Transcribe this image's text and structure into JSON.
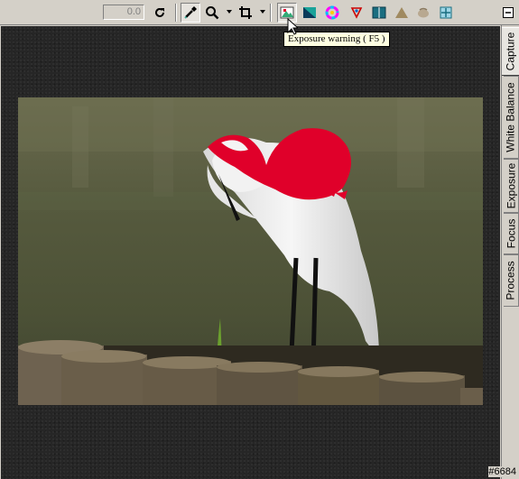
{
  "toolbar": {
    "rotation_value": "0.0",
    "tools": [
      {
        "name": "rotate",
        "icon": "rotate-icon"
      },
      {
        "name": "eyedropper",
        "icon": "eyedropper-icon"
      },
      {
        "name": "zoom",
        "icon": "magnifier-icon"
      },
      {
        "name": "crop",
        "icon": "crop-icon"
      },
      {
        "name": "exposure-warning",
        "icon": "exposure-warning-icon"
      },
      {
        "name": "shadow",
        "icon": "shadow-icon"
      },
      {
        "name": "color-wheel",
        "icon": "color-wheel-icon"
      },
      {
        "name": "focus",
        "icon": "focus-icon"
      },
      {
        "name": "compare",
        "icon": "compare-icon"
      },
      {
        "name": "triangle",
        "icon": "triangle-icon"
      },
      {
        "name": "hand",
        "icon": "hand-icon"
      },
      {
        "name": "fit",
        "icon": "fit-icon"
      }
    ]
  },
  "tooltip": "Exposure warning ( F5 )",
  "tabs": [
    {
      "label": "Capture",
      "active": true
    },
    {
      "label": "White Balance",
      "active": false
    },
    {
      "label": "Exposure",
      "active": false
    },
    {
      "label": "Focus",
      "active": false
    },
    {
      "label": "Process",
      "active": false
    }
  ],
  "status": {
    "counter": "#6684"
  },
  "colors": {
    "warning": "#e0002a",
    "canvas": "#262626",
    "chrome": "#d4d0c8"
  }
}
